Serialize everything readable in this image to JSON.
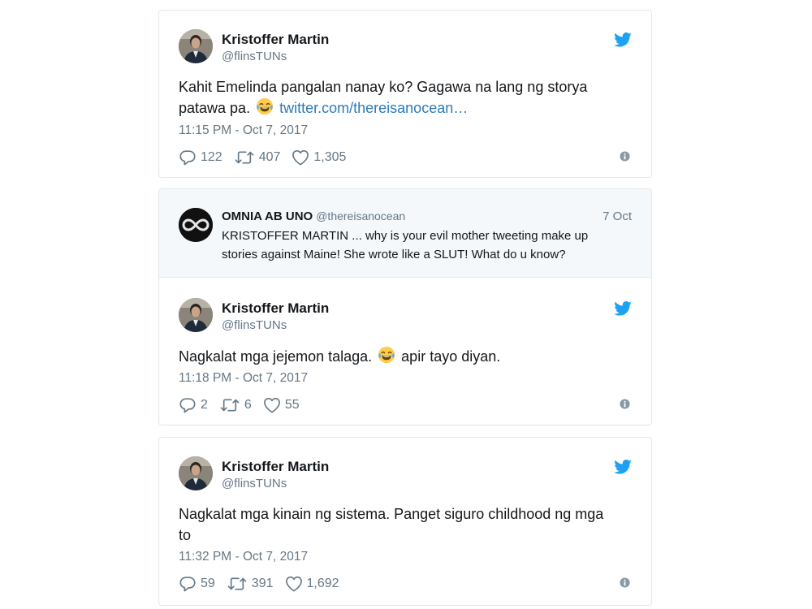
{
  "tweets": [
    {
      "name": "Kristoffer Martin",
      "handle": "@flinsTUNs",
      "text_before_emoji": "Kahit Emelinda pangalan nanay ko? Gagawa na lang ng storya patawa pa.",
      "link": "twitter.com/thereisanocean…",
      "timestamp": "11:15 PM - Oct 7, 2017",
      "replies": "122",
      "retweets": "407",
      "likes": "1,305"
    },
    {
      "quoted": {
        "name": "OMNIA AB UNO",
        "handle": "@thereisanocean",
        "date": "7 Oct",
        "text": "KRISTOFFER MARTIN ... why is your evil mother tweeting make up stories against Maine! She wrote like a SLUT! What do u know?"
      },
      "name": "Kristoffer Martin",
      "handle": "@flinsTUNs",
      "text_before_emoji": "Nagkalat mga jejemon talaga.",
      "text_after_emoji": "apir tayo diyan.",
      "timestamp": "11:18 PM - Oct 7, 2017",
      "replies": "2",
      "retweets": "6",
      "likes": "55"
    },
    {
      "name": "Kristoffer Martin",
      "handle": "@flinsTUNs",
      "text": "Nagkalat mga kinain ng sistema. Panget siguro childhood ng mga to",
      "timestamp": "11:32 PM - Oct 7, 2017",
      "replies": "59",
      "retweets": "391",
      "likes": "1,692"
    }
  ],
  "icons": {
    "brand": "twitter-bird-icon",
    "reply": "reply-icon",
    "retweet": "retweet-icon",
    "like": "heart-icon",
    "info": "info-icon",
    "emoji": "tears-of-joy-emoji"
  },
  "colors": {
    "twitter_blue": "#1da1f2",
    "link": "#2b7bb9",
    "muted": "#657786",
    "border": "#e1e8ed",
    "quote_bg": "#f5f8fa"
  }
}
